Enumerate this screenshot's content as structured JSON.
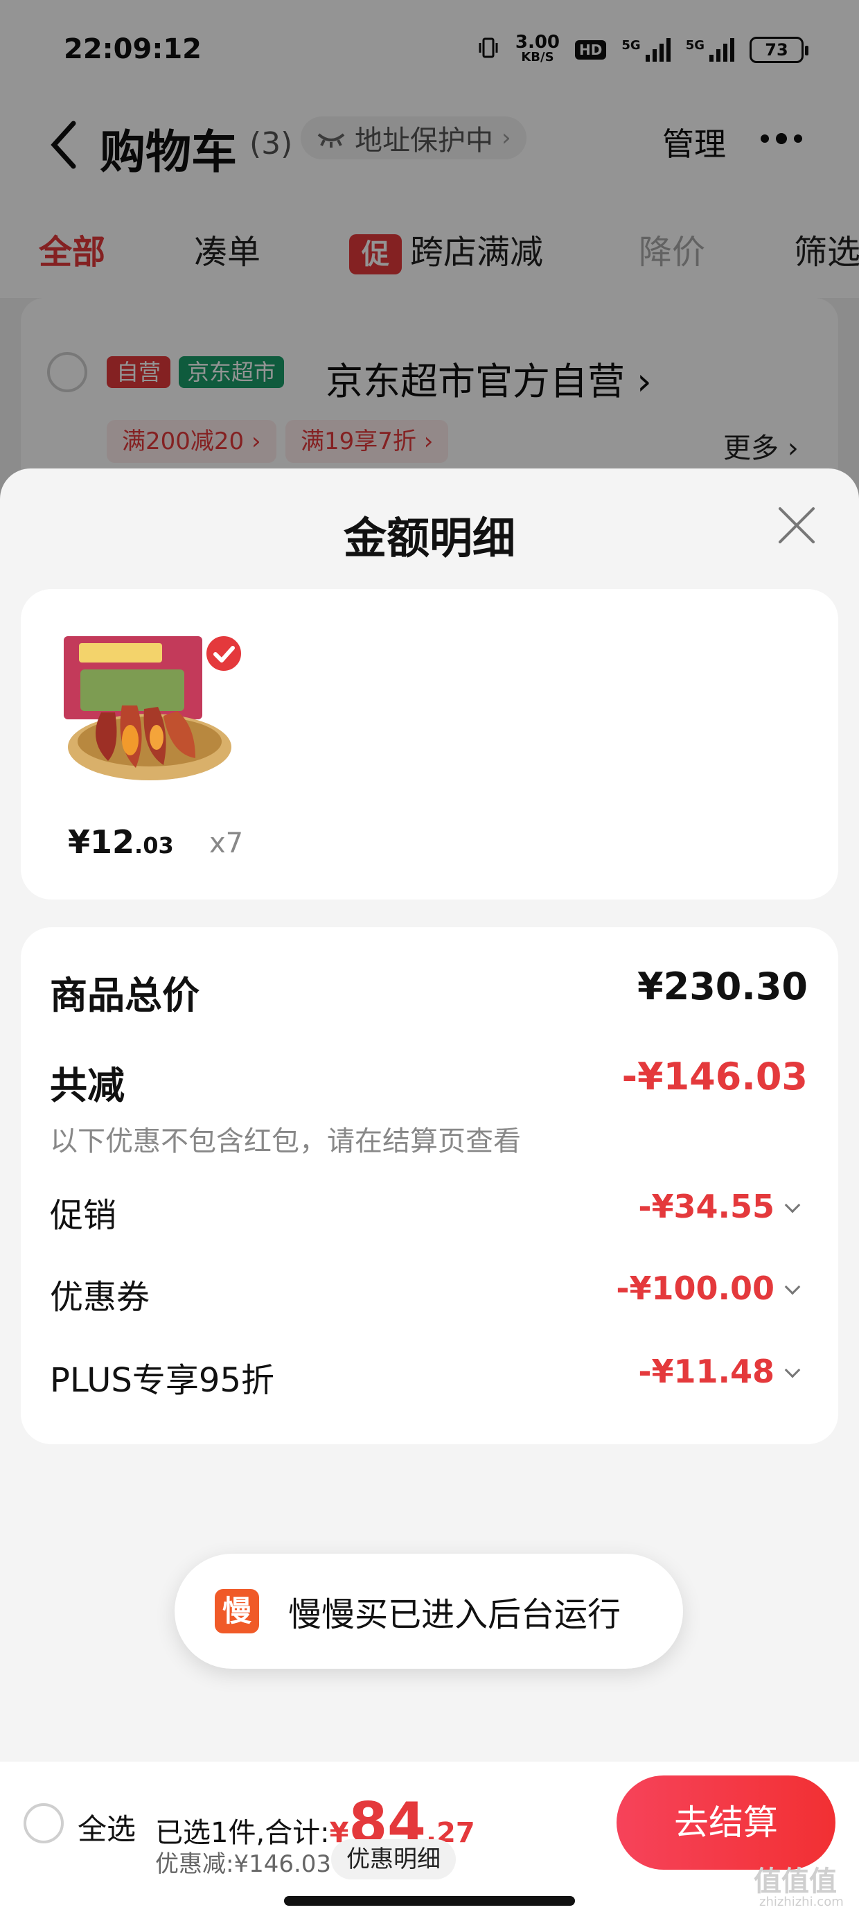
{
  "status_bar": {
    "time": "22:09:12",
    "net_speed": "3.00",
    "net_unit": "KB/S",
    "hd": "HD",
    "network": "5G",
    "battery": "73"
  },
  "header": {
    "title": "购物车",
    "count": "(3)",
    "address": "地址保护中",
    "manage": "管理"
  },
  "tabs": {
    "all": "全部",
    "bundle": "凑单",
    "promo_icon": "促",
    "cross_store": "跨店满减",
    "price_drop": "降价",
    "filter": "筛选"
  },
  "store": {
    "tag_self": "自营",
    "tag_market": "京东超市",
    "name": "京东超市官方自营 ›",
    "promos": [
      "满200减20 ›",
      "满19享7折 ›"
    ],
    "more": "更多 ›"
  },
  "sheet": {
    "title": "金额明细",
    "product": {
      "price_int": "¥12",
      "price_dec": ".03",
      "qty": "x7"
    },
    "summary": {
      "total_label": "商品总价",
      "total_value": "¥230.30",
      "reduce_label": "共减",
      "reduce_value": "-¥146.03",
      "note": "以下优惠不包含红包，请在结算页查看",
      "items": [
        {
          "label": "促销",
          "value": "-¥34.55"
        },
        {
          "label": "优惠券",
          "value": "-¥100.00"
        },
        {
          "label": "PLUS专享95折",
          "value": "-¥11.48"
        }
      ]
    }
  },
  "toast": {
    "icon": "慢",
    "text": "慢慢买已进入后台运行"
  },
  "bottom_bar": {
    "select_all": "全选",
    "selected_label": "已选1件,合计:",
    "currency": "¥",
    "total_int": "84",
    "total_dec": ".27",
    "discount": "优惠减:¥146.03",
    "detail": "优惠明细",
    "checkout": "去结算"
  },
  "watermark": {
    "main": "值值值",
    "sub": "zhizhizhi.com"
  },
  "colors": {
    "accent_red": "#e4393c",
    "market_green": "#1a9e6a",
    "toast_orange": "#f05a28"
  }
}
